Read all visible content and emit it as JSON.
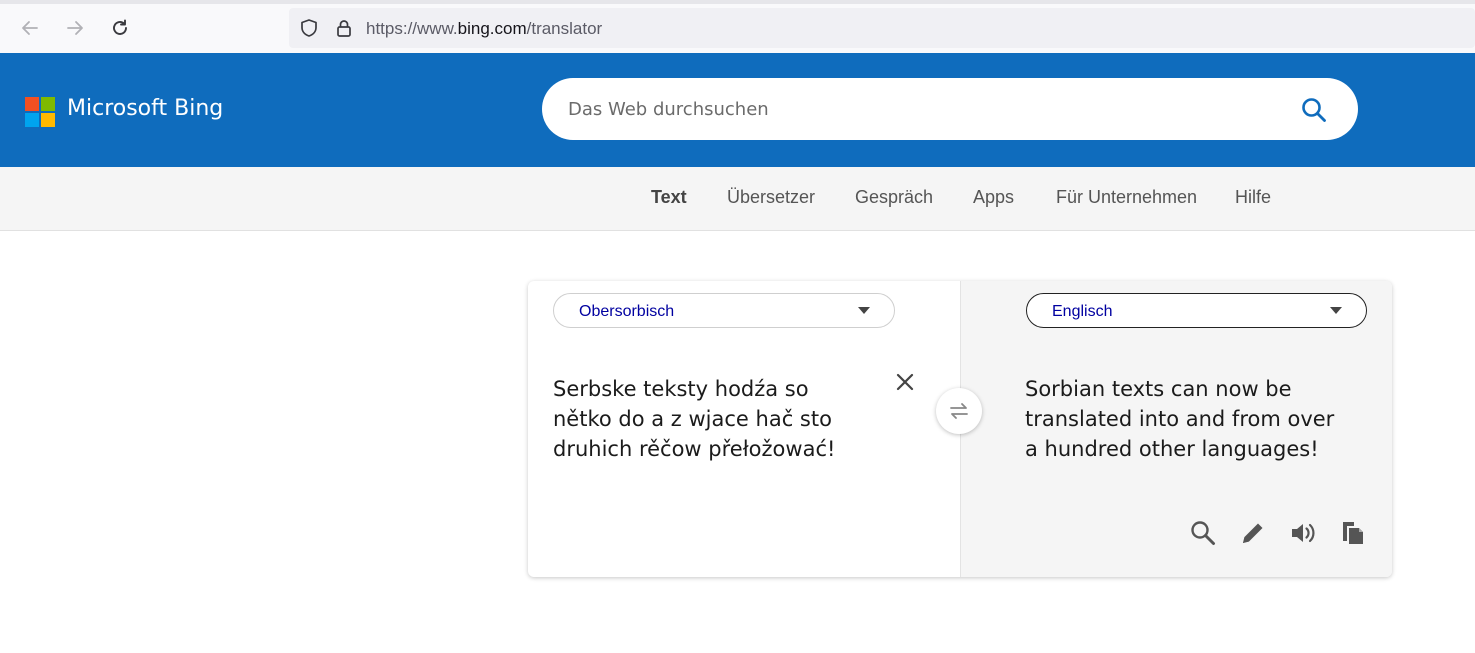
{
  "browser": {
    "url_prefix": "https://www.",
    "url_domain": "bing.com",
    "url_path": "/translator"
  },
  "header": {
    "brand": "Microsoft Bing",
    "logo_colors": [
      "#f25022",
      "#7fba00",
      "#00a4ef",
      "#ffb900"
    ],
    "search_placeholder": "Das Web durchsuchen"
  },
  "nav": {
    "items": [
      {
        "label": "Text",
        "active": true
      },
      {
        "label": "Übersetzer"
      },
      {
        "label": "Gespräch"
      },
      {
        "label": "Apps"
      },
      {
        "label": "Für Unternehmen"
      },
      {
        "label": "Hilfe"
      }
    ]
  },
  "translator": {
    "source_language": "Obersorbisch",
    "target_language": "Englisch",
    "source_text": "Serbske teksty hodźa so nětko do a z wjace hač sto druhich rěčow přełožować!",
    "target_text": "Sorbian texts can now be translated into and from over a hundred other languages!"
  },
  "colors": {
    "header_blue": "#0f6cbd",
    "language_text": "#0000a0"
  }
}
